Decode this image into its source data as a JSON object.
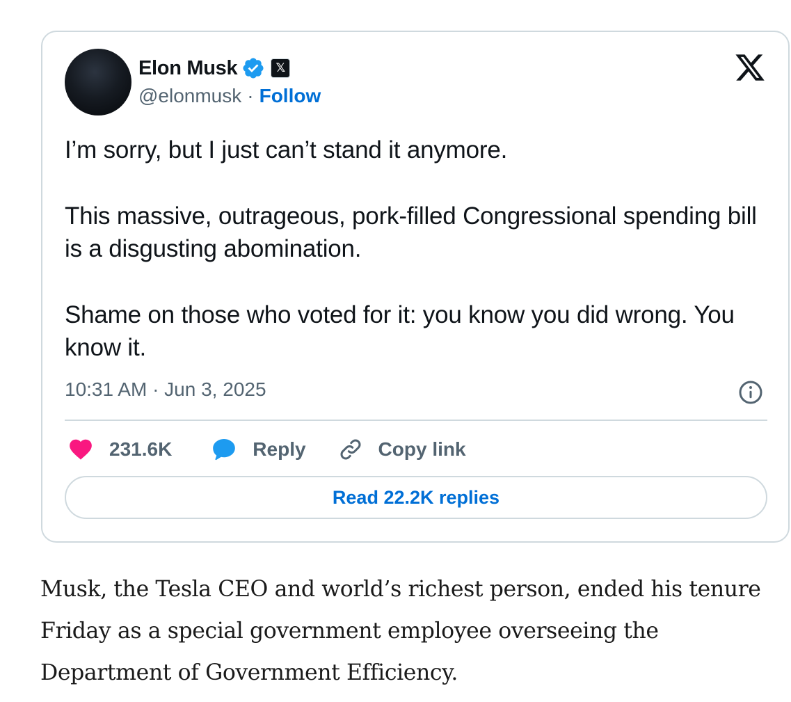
{
  "tweet": {
    "author": {
      "display_name": "Elon Musk",
      "handle": "@elonmusk",
      "separator": "·",
      "follow_label": "Follow",
      "verified_badge_icon": "verified-check-icon",
      "affiliate_badge_text": "𝕏"
    },
    "paragraphs": [
      "I’m sorry, but I just can’t stand it anymore.",
      "This massive, outrageous, pork-filled Congressional spending bill is a disgusting abomination.",
      "Shame on those who voted for it: you know you did wrong. You know it."
    ],
    "timestamp": "10:31 AM · Jun 3, 2025",
    "actions": {
      "likes_count": "231.6K",
      "reply_label": "Reply",
      "copy_link_label": "Copy link"
    },
    "read_replies_label": "Read 22.2K replies"
  },
  "article": {
    "paragraph": "Musk, the Tesla CEO and world’s richest person, ended his tenure Friday as a special government employee overseeing the Department of Government Efficiency."
  },
  "colors": {
    "accent_blue": "#006fd6",
    "verified_blue": "#1d9bf0",
    "like_pink": "#f91880",
    "reply_blue": "#1d9bf0",
    "muted_gray": "#536471",
    "border_gray": "#cfd9de"
  },
  "icons": [
    "x-logo-icon",
    "verified-check-icon",
    "heart-icon",
    "reply-bubble-icon",
    "link-icon",
    "info-icon"
  ]
}
